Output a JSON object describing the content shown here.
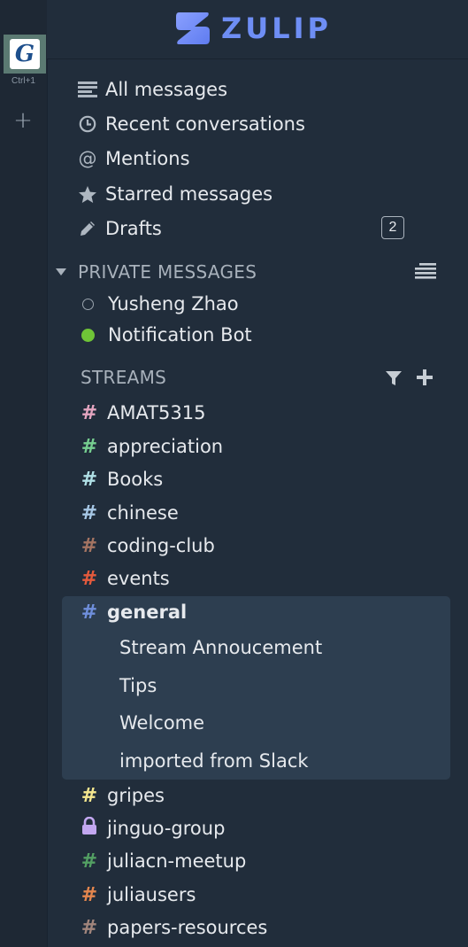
{
  "org_switcher": {
    "logo_letter": "G",
    "shortcut": "Ctrl+1",
    "add_label": "+"
  },
  "brand": {
    "name": "ZULIP",
    "color": "#6e8ef5"
  },
  "views": [
    {
      "label": "All messages",
      "icon": "all-messages-icon"
    },
    {
      "label": "Recent conversations",
      "icon": "clock-icon"
    },
    {
      "label": "Mentions",
      "icon": "at-icon"
    },
    {
      "label": "Starred messages",
      "icon": "star-icon"
    },
    {
      "label": "Drafts",
      "icon": "pencil-icon",
      "count": "2"
    }
  ],
  "private_messages": {
    "header": "PRIVATE MESSAGES",
    "users": [
      {
        "name": "Yusheng Zhao",
        "status": "offline"
      },
      {
        "name": "Notification Bot",
        "status": "active"
      }
    ]
  },
  "streams": {
    "header": "STREAMS",
    "items": [
      {
        "name": "AMAT5315",
        "color": "#e4a5c0",
        "icon": "hash-icon"
      },
      {
        "name": "appreciation",
        "color": "#76ce90",
        "icon": "hash-icon"
      },
      {
        "name": "Books",
        "color": "#b0e0e6",
        "icon": "hash-icon"
      },
      {
        "name": "chinese",
        "color": "#a6c7e5",
        "icon": "hash-icon"
      },
      {
        "name": "coding-club",
        "color": "#a47462",
        "icon": "hash-icon"
      },
      {
        "name": "events",
        "color": "#e55a3c",
        "icon": "hash-icon"
      },
      {
        "name": "general",
        "color": "#6f8fdc",
        "icon": "hash-icon",
        "active": true,
        "topics": [
          "Stream Annoucement",
          "Tips",
          "Welcome",
          "imported from Slack"
        ]
      },
      {
        "name": "gripes",
        "color": "#f5e78f",
        "icon": "hash-icon"
      },
      {
        "name": "jinguo-group",
        "color": "#c2a7f0",
        "icon": "lock-icon"
      },
      {
        "name": "juliacn-meetup",
        "color": "#53a063",
        "icon": "hash-icon"
      },
      {
        "name": "juliausers",
        "color": "#e4864e",
        "icon": "hash-icon"
      },
      {
        "name": "papers-resources",
        "color": "#a1857c",
        "icon": "hash-icon"
      }
    ]
  }
}
